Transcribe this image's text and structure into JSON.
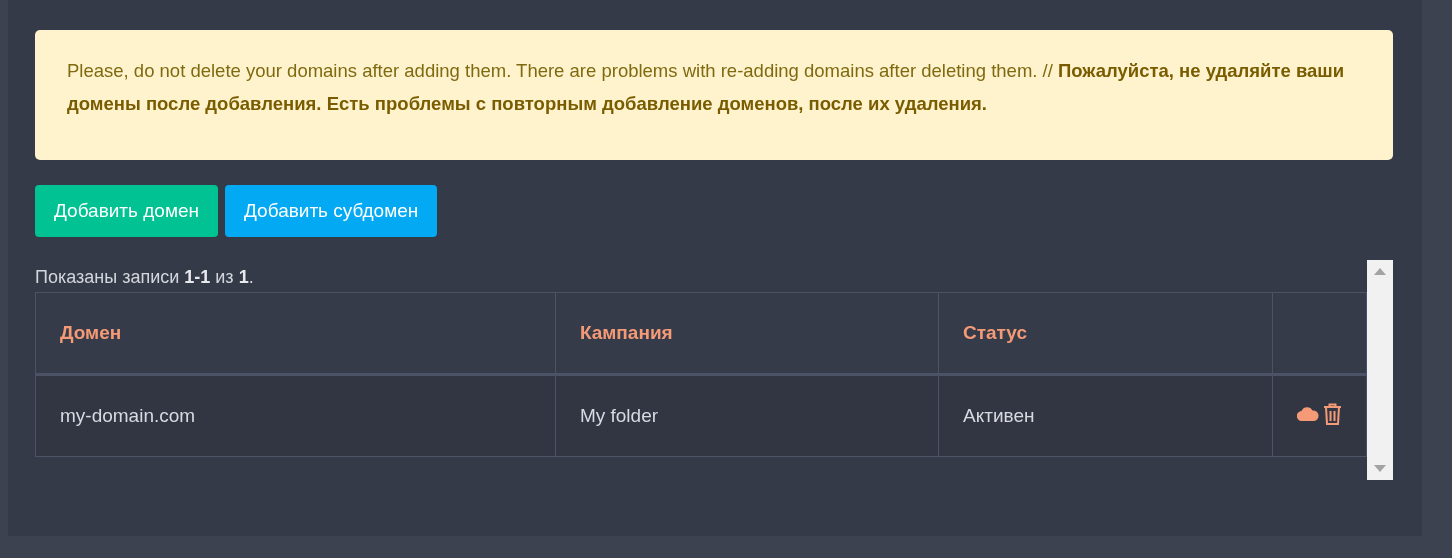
{
  "alert": {
    "text": "Please, do not delete your domains after adding them. There are problems with re-adding domains after deleting them. // **Пожалуйста, не удаляйте ваши домены после добавления. Есть проблемы с повторным добавление доменов, после их удаления.**"
  },
  "buttons": [
    {
      "label": "Добавить домен",
      "kind": "success"
    },
    {
      "label": "Добавить субдомен",
      "kind": "info"
    }
  ],
  "summary": "Показаны записи **1-1** из **1**.",
  "table": {
    "columns": [
      "Домен",
      "Кампания",
      "Статус"
    ],
    "rows": [
      {
        "cells": [
          "my-domain.com",
          "My folder",
          "Активен"
        ]
      }
    ]
  }
}
